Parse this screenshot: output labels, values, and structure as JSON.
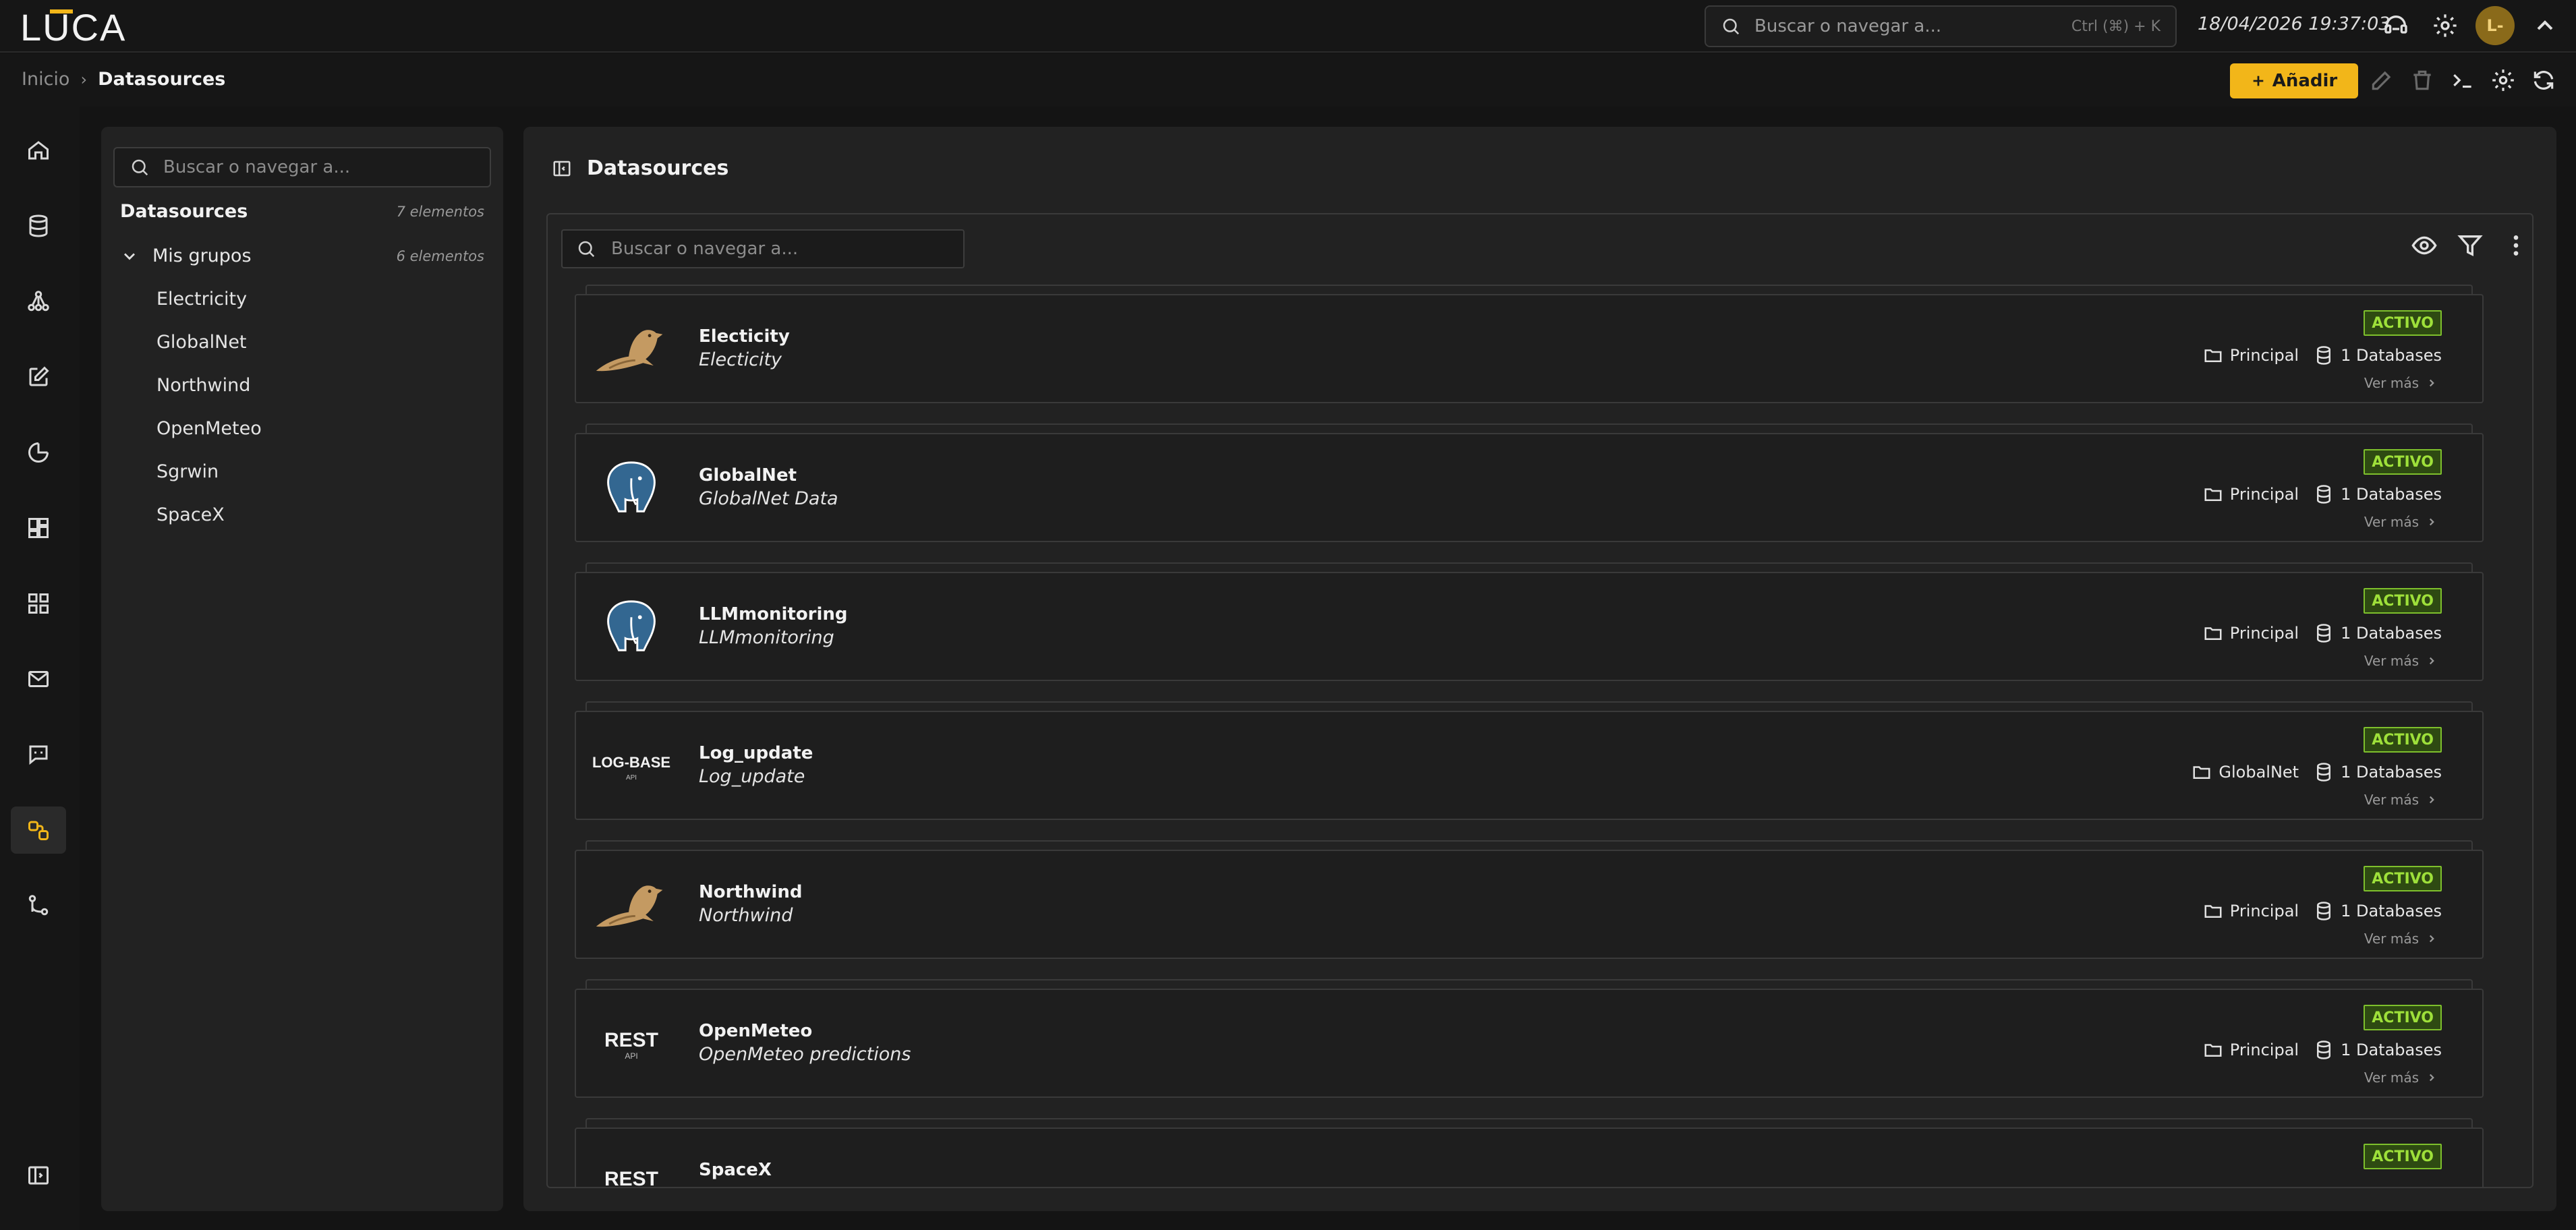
{
  "app": {
    "logo_text": "LUCA"
  },
  "topbar": {
    "search_placeholder": "Buscar o navegar a...",
    "search_shortcut": "Ctrl (⌘) + K",
    "datetime": "18/04/2026 19:37:03",
    "avatar_initial": "L-"
  },
  "breadcrumb": {
    "home": "Inicio",
    "separator": "›",
    "current": "Datasources"
  },
  "toolbar": {
    "add_label": "Añadir"
  },
  "colors": {
    "accent": "#f2b619",
    "active_border": "#7ec02c",
    "active_text": "#9ee03a"
  },
  "tree": {
    "search_placeholder": "Buscar o navegar a...",
    "root_label": "Datasources",
    "root_count": "7 elementos",
    "group_label": "Mis grupos",
    "group_count": "6 elementos",
    "items": [
      "Electricity",
      "GlobalNet",
      "Northwind",
      "OpenMeteo",
      "Sgrwin",
      "SpaceX"
    ]
  },
  "main": {
    "title": "Datasources",
    "search_placeholder": "Buscar o navegar a...",
    "cards": [
      {
        "name": "Electicity",
        "description": "Electicity",
        "status": "ACTIVO",
        "group": "Principal",
        "databases": "1 Databases",
        "more": "Ver más",
        "logo": "mysql-dolphin-icon"
      },
      {
        "name": "GlobalNet",
        "description": "GlobalNet Data",
        "status": "ACTIVO",
        "group": "Principal",
        "databases": "1 Databases",
        "more": "Ver más",
        "logo": "postgres-elephant-icon"
      },
      {
        "name": "LLMmonitoring",
        "description": "LLMmonitoring",
        "status": "ACTIVO",
        "group": "Principal",
        "databases": "1 Databases",
        "more": "Ver más",
        "logo": "postgres-elephant-icon"
      },
      {
        "name": "Log_update",
        "description": "Log_update",
        "status": "ACTIVO",
        "group": "GlobalNet",
        "databases": "1 Databases",
        "more": "Ver más",
        "logo": "logbase-api-icon",
        "logo_text": "LOG-BASE",
        "logo_sub": "API"
      },
      {
        "name": "Northwind",
        "description": "Northwind",
        "status": "ACTIVO",
        "group": "Principal",
        "databases": "1 Databases",
        "more": "Ver más",
        "logo": "mysql-dolphin-icon"
      },
      {
        "name": "OpenMeteo",
        "description": "OpenMeteo predictions",
        "status": "ACTIVO",
        "group": "Principal",
        "databases": "1 Databases",
        "more": "Ver más",
        "logo": "rest-api-icon",
        "logo_text": "REST",
        "logo_sub": "API"
      },
      {
        "name": "SpaceX",
        "description": "",
        "status": "ACTIVO",
        "group": "",
        "databases": "",
        "more": "",
        "logo": "rest-api-icon",
        "logo_text": "REST",
        "logo_sub": ""
      }
    ]
  }
}
